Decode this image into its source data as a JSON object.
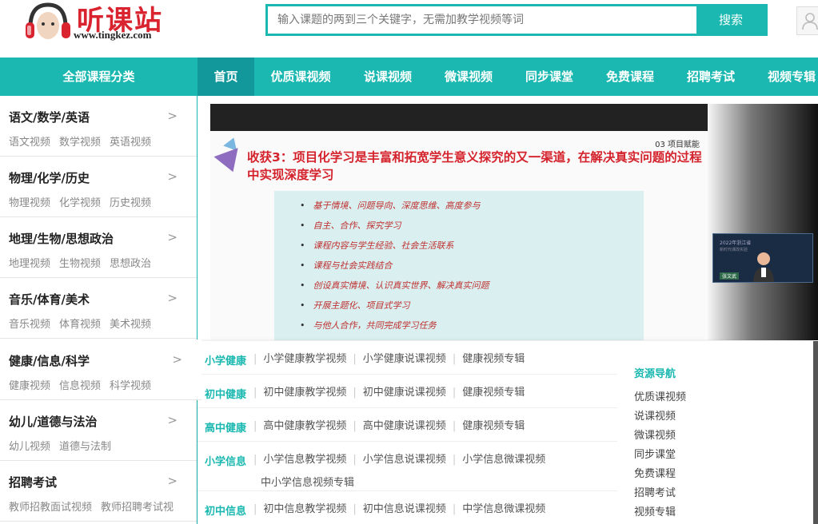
{
  "header": {
    "logo_cn": "听课站",
    "logo_url": "www.tingkez.com",
    "search_placeholder": "输入课题的两到三个关键字，无需加教学视频等词",
    "search_button": "搜索"
  },
  "nav": {
    "all_categories": "全部课程分类",
    "items": [
      {
        "label": "首页"
      },
      {
        "label": "优质课视频"
      },
      {
        "label": "说课视频"
      },
      {
        "label": "微课视频"
      },
      {
        "label": "同步课堂"
      },
      {
        "label": "免费课程"
      },
      {
        "label": "招聘考试"
      },
      {
        "label": "视频专辑"
      }
    ]
  },
  "sidebar": {
    "arrow": ">",
    "categories": [
      {
        "title": "语文/数学/英语",
        "links": [
          "语文视频",
          "数学视频",
          "英语视频"
        ]
      },
      {
        "title": "物理/化学/历史",
        "links": [
          "物理视频",
          "化学视频",
          "历史视频"
        ]
      },
      {
        "title": "地理/生物/思想政治",
        "links": [
          "地理视频",
          "生物视频",
          "思想政治"
        ]
      },
      {
        "title": "音乐/体育/美术",
        "links": [
          "音乐视频",
          "体育视频",
          "美术视频"
        ]
      },
      {
        "title": "健康/信息/科学",
        "links": [
          "健康视频",
          "信息视频",
          "科学视频"
        ]
      },
      {
        "title": "幼儿/道德与法治",
        "links": [
          "幼儿视频",
          "道德与法制"
        ]
      },
      {
        "title": "招聘考试",
        "links": [
          "教师招教面试视频",
          "教师招聘考试视"
        ]
      }
    ]
  },
  "video": {
    "slide_label": "03 项目赋能",
    "slide_title": "收获3：项目化学习是丰富和拓宽学生意义探究的又一渠道，在解决真实问题的过程中实现深度学习",
    "bullets": [
      "基于情境、问题导向、深度思维、高度参与",
      "自主、合作、探究学习",
      "课程内容与学生经验、社会生活联系",
      "课程与社会实践结合",
      "创设真实情境、认识真实世界、解决真实问题",
      "开展主题化、项目式学习",
      "与他人合作，共同完成学习任务"
    ],
    "pip_line1": "2022年浙江省",
    "pip_line2": "新时代课改实验",
    "pip_name": "张文武"
  },
  "dropdown": {
    "rows": [
      {
        "title": "小学健康",
        "links": [
          "小学健康教学视频",
          "小学健康说课视频",
          "健康视频专辑"
        ],
        "extra": ""
      },
      {
        "title": "初中健康",
        "links": [
          "初中健康教学视频",
          "初中健康说课视频",
          "健康视频专辑"
        ],
        "extra": ""
      },
      {
        "title": "高中健康",
        "links": [
          "高中健康教学视频",
          "高中健康说课视频",
          "健康视频专辑"
        ],
        "extra": ""
      },
      {
        "title": "小学信息",
        "links": [
          "小学信息教学视频",
          "小学信息说课视频",
          "小学信息微课视频"
        ],
        "extra": "中小学信息视频专辑"
      },
      {
        "title": "初中信息",
        "links": [
          "初中信息教学视频",
          "初中信息说课视频",
          "中学信息微课视频"
        ],
        "extra": ""
      }
    ],
    "resource_nav": {
      "title": "资源导航",
      "items": [
        "优质课视频",
        "说课视频",
        "微课视频",
        "同步课堂",
        "免费课程",
        "招聘考试",
        "视频专辑"
      ]
    }
  },
  "colors": {
    "accent": "#1ab8b0",
    "accent_dark": "#12979a",
    "logo_red": "#d9232e",
    "slide_red": "#d4232c"
  },
  "icons": {
    "logo": "headphones-icon",
    "user": "user-icon"
  }
}
